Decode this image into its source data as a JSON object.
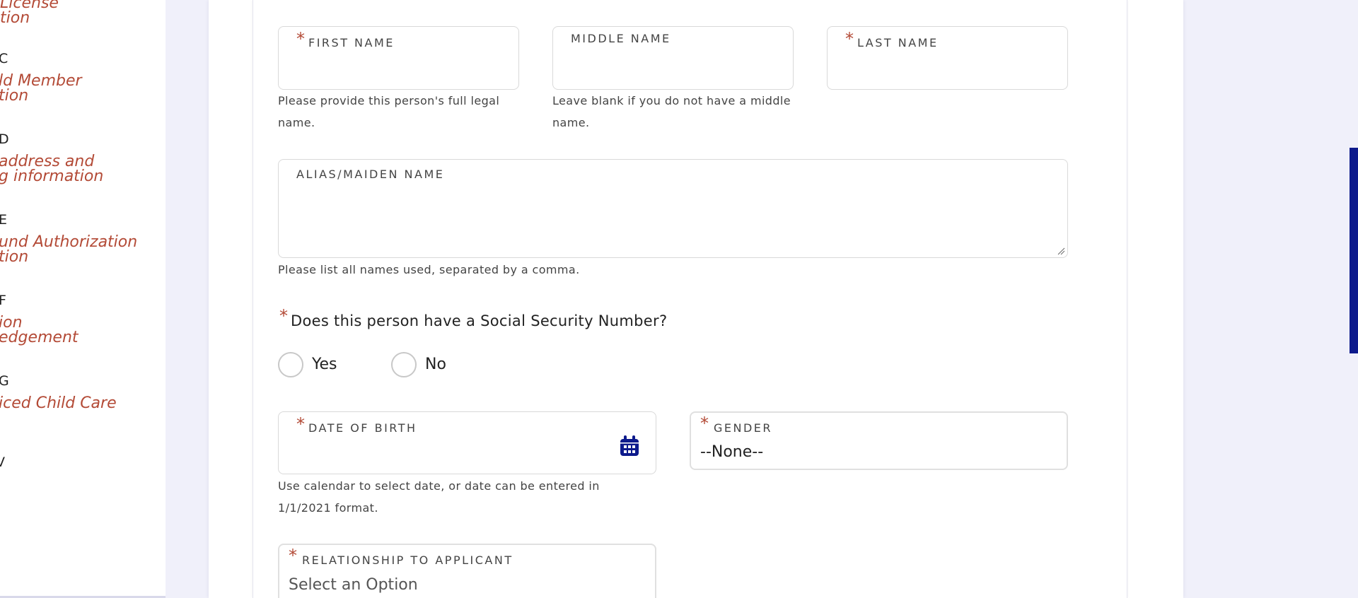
{
  "sidebar": {
    "steps": [
      {
        "letter": "",
        "title_lines": [
          "License",
          "tion"
        ]
      },
      {
        "letter": "C",
        "title_lines": [
          "ld Member",
          "tion"
        ]
      },
      {
        "letter": "D",
        "title_lines": [
          " address and",
          "g information"
        ]
      },
      {
        "letter": "E",
        "title_lines": [
          "und Authorization",
          "tion"
        ]
      },
      {
        "letter": "F",
        "title_lines": [
          "ion",
          "edgement"
        ]
      },
      {
        "letter": "G",
        "title_lines": [
          "iced Child Care"
        ]
      },
      {
        "letter": "V",
        "title_lines": []
      }
    ]
  },
  "form": {
    "first_name": {
      "label": "FIRST NAME",
      "required": true,
      "value": "",
      "help": "Please provide this person's full legal name."
    },
    "middle_name": {
      "label": "MIDDLE NAME",
      "required": false,
      "value": "",
      "help": "Leave blank if you do not have a middle name."
    },
    "last_name": {
      "label": "LAST NAME",
      "required": true,
      "value": ""
    },
    "alias": {
      "label": "ALIAS/MAIDEN NAME",
      "value": "",
      "help": "Please list all names used, separated by a comma."
    },
    "ssn_question": {
      "label": "Does this person have a Social Security Number?",
      "required": true,
      "options": [
        "Yes",
        "No"
      ],
      "selected": null
    },
    "dob": {
      "label": "DATE OF BIRTH",
      "required": true,
      "value": "",
      "icon": "calendar-icon",
      "help": "Use calendar to select date, or date can be entered in 1/1/2021 format."
    },
    "gender": {
      "label": "GENDER",
      "required": true,
      "value": "--None--"
    },
    "relationship": {
      "label": "RELATIONSHIP TO APPLICANT",
      "required": true,
      "placeholder": "Select an Option"
    }
  },
  "colors": {
    "accent": "#b34a36",
    "brand": "#0d1a8c",
    "background": "#f0f0fa"
  }
}
